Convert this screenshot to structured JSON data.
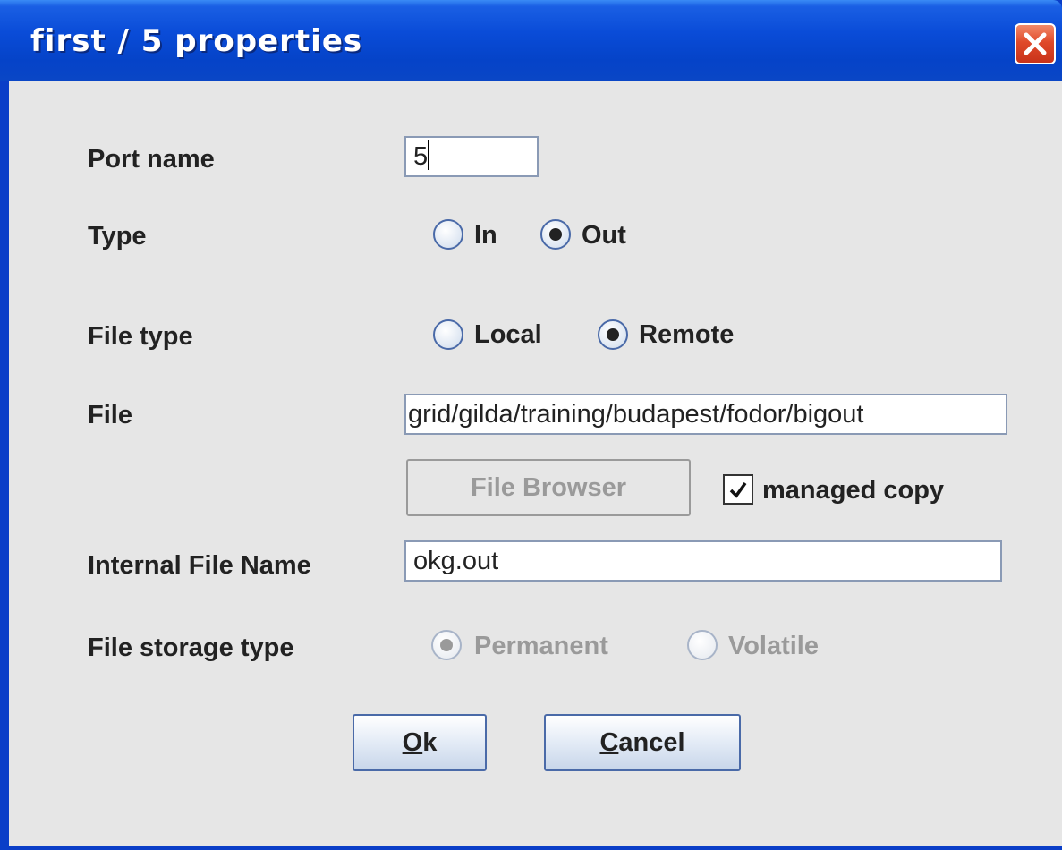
{
  "window": {
    "title": "first / 5 properties"
  },
  "form": {
    "port_name": {
      "label": "Port name",
      "value": "5"
    },
    "type": {
      "label": "Type",
      "options": [
        "In",
        "Out"
      ],
      "selected": "Out"
    },
    "file_type": {
      "label": "File type",
      "options": [
        "Local",
        "Remote"
      ],
      "selected": "Remote"
    },
    "file": {
      "label": "File",
      "value": "grid/gilda/training/budapest/fodor/bigout"
    },
    "file_browser_label": "File Browser",
    "managed_copy": {
      "label": "managed copy",
      "checked": true
    },
    "internal_file_name": {
      "label": "Internal File Name",
      "value": "okg.out"
    },
    "file_storage_type": {
      "label": "File storage type",
      "options": [
        "Permanent",
        "Volatile"
      ],
      "selected": "Permanent",
      "disabled": true
    }
  },
  "buttons": {
    "ok_mnemonic": "O",
    "ok_rest": "k",
    "cancel_mnemonic": "C",
    "cancel_rest": "ancel"
  },
  "icons": {
    "close": "close-icon",
    "check": "check-icon"
  },
  "colors": {
    "titlebar": "#0543c8",
    "content_bg": "#e6e6e6",
    "close_button": "#e04a2a"
  }
}
